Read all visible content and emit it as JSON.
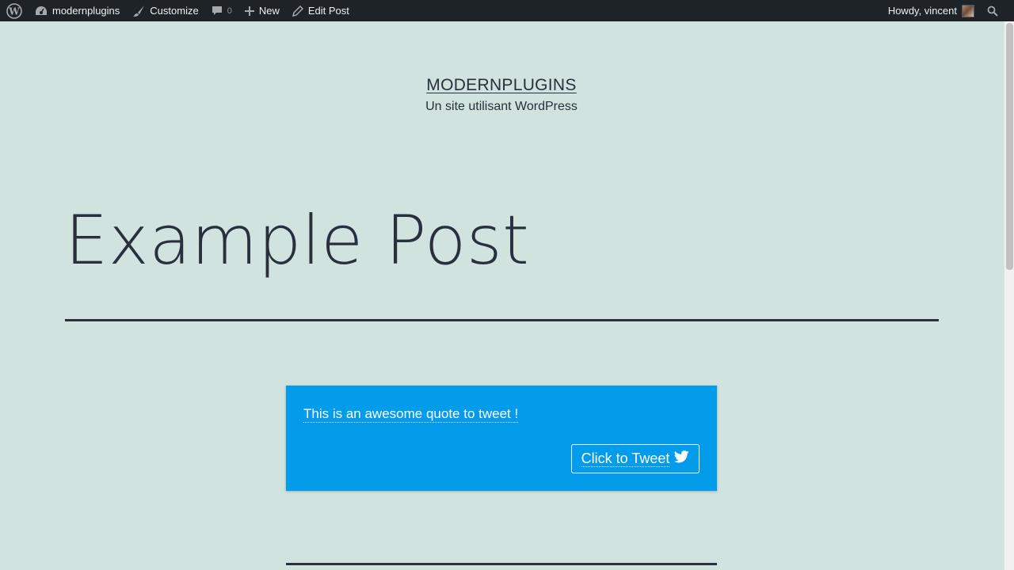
{
  "adminbar": {
    "site_name": "modernplugins",
    "customize": "Customize",
    "comments_count": "0",
    "new_label": "New",
    "edit_post": "Edit Post",
    "greeting": "Howdy, vincent"
  },
  "site": {
    "title": "MODERNPLUGINS",
    "description": "Un site utilisant WordPress"
  },
  "post": {
    "title": "Example Post"
  },
  "tweet": {
    "quote": "This is an awesome quote to tweet !",
    "button_label": "Click to Tweet"
  },
  "colors": {
    "page_background": "#d0e3de",
    "admin_bar": "#1d2327",
    "tweet_box": "#039cea",
    "text": "#28303d"
  },
  "icons": [
    "wordpress-logo-icon",
    "dashboard-icon",
    "brush-icon",
    "comment-icon",
    "plus-icon",
    "pencil-icon",
    "search-icon",
    "twitter-bird-icon"
  ]
}
